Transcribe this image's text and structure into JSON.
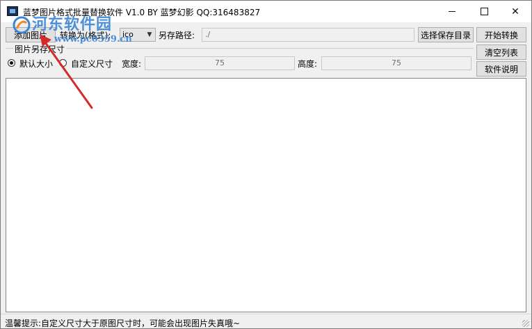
{
  "window": {
    "title": "蓝梦图片格式批量替换软件 V1.0 BY 蓝梦幻影 QQ:316483827"
  },
  "toolbar": {
    "add_image_label": "添加图片",
    "convert_to_label": "转换为(格式):",
    "format_value": "ico",
    "save_path_label": "另存路径:",
    "save_path_value": "./",
    "choose_dir_label": "选择保存目录",
    "start_label": "开始转换",
    "clear_label": "清空列表",
    "help_label": "软件说明"
  },
  "size_group": {
    "legend": "图片另存尺寸",
    "default_option": "默认大小",
    "custom_option": "自定义尺寸",
    "selected": "默认大小",
    "width_label": "宽度:",
    "width_value": "75",
    "height_label": "高度:",
    "height_value": "75"
  },
  "status": {
    "tip": "温馨提示:自定义尺寸大于原图尺寸时，可能会出现图片失真哦~"
  },
  "watermark": {
    "site_name": "河东软件园",
    "url": "www.pc0359.cn"
  },
  "colors": {
    "watermark_blue": "#3b85d7",
    "arrow_red": "#d62a2a"
  }
}
